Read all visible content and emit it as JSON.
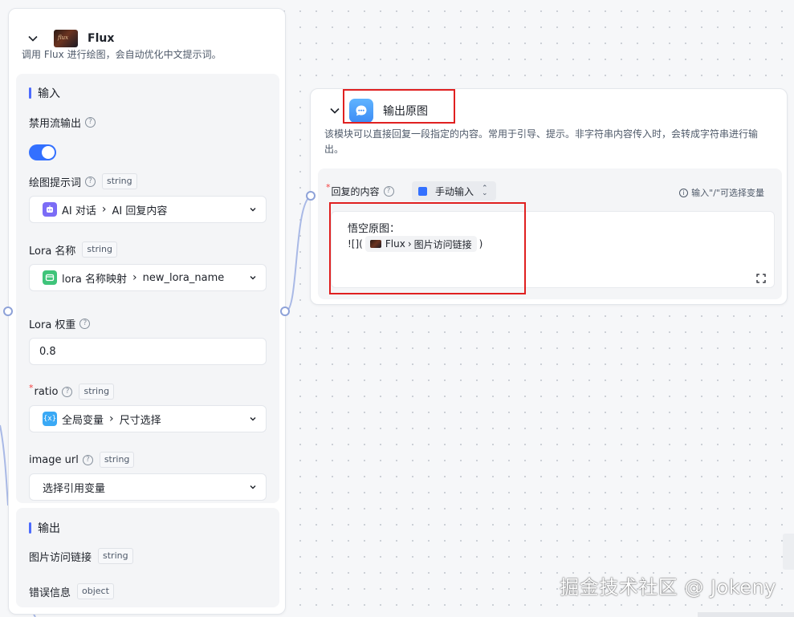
{
  "flux_node": {
    "title": "Flux",
    "description": "调用 Flux 进行绘图，会自动优化中文提示词。",
    "input_section": {
      "title": "输入",
      "stream_toggle": {
        "label": "禁用流输出",
        "on": true
      },
      "prompt": {
        "label": "绘图提示词",
        "type": "string",
        "source_label": "AI 对话",
        "value": "AI 回复内容"
      },
      "lora_name": {
        "label": "Lora 名称",
        "type": "string",
        "source_label": "lora 名称映射",
        "value": "new_lora_name"
      },
      "lora_weight": {
        "label": "Lora 权重",
        "value": "0.8"
      },
      "ratio": {
        "required_mark": "*",
        "label": "ratio",
        "type": "string",
        "source_label": "全局变量",
        "value": "尺寸选择"
      },
      "image_url": {
        "label": "image url",
        "type": "string",
        "placeholder": "选择引用变量"
      }
    },
    "output_section": {
      "title": "输出",
      "outputs": [
        {
          "label": "图片访问链接",
          "type": "string"
        },
        {
          "label": "错误信息",
          "type": "object"
        }
      ]
    }
  },
  "output_node": {
    "title": "输出原图",
    "description": "该模块可以直接回复一段指定的内容。常用于引导、提示。非字符串内容传入时，会转成字符串进行输出。",
    "reply": {
      "required_mark": "*",
      "label": "回复的内容",
      "mode": "手动输入",
      "hint": "输入\"/\"可选择变量",
      "line1": "悟空原图：",
      "prefix": "![](",
      "chip_node": "Flux",
      "chip_field": "图片访问链接",
      "suffix": ")"
    }
  },
  "watermark": "掘金技术社区 @ Jokeny",
  "colors": {
    "accent": "#3370ff",
    "highlight_box": "#e02020",
    "edge": "#8ea2d8"
  }
}
